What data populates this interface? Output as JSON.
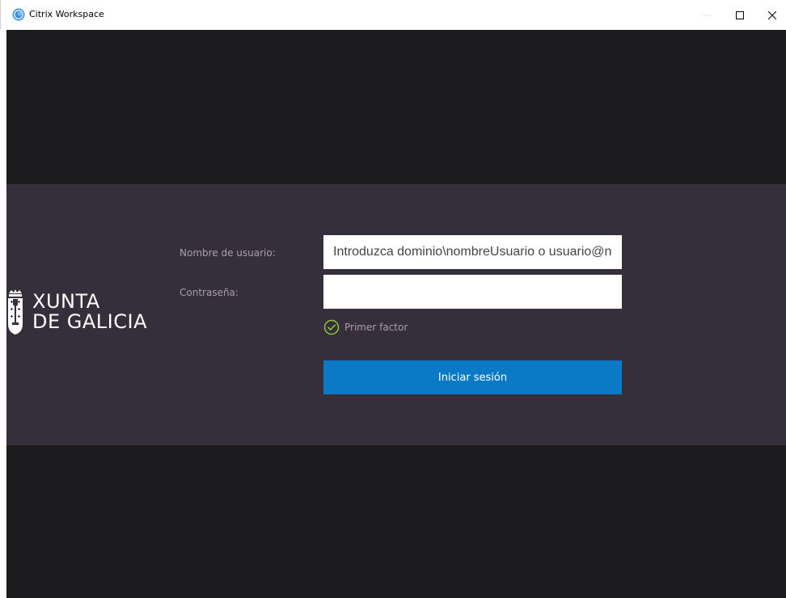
{
  "window": {
    "title": "Citrix Workspace",
    "icon": "citrix-workspace-icon",
    "controls": {
      "minimize_icon": "minimize-icon",
      "maximize_icon": "maximize-icon",
      "close_icon": "close-icon"
    }
  },
  "logo": {
    "line1": "XUNTA",
    "line2": "DE GALICIA",
    "icon": "galicia-crest-icon"
  },
  "form": {
    "username_label": "Nombre de usuario:",
    "username_placeholder": "Introduzca dominio\\nombreUsuario o usuario@n...",
    "username_value": "",
    "password_label": "Contraseña:",
    "password_value": "",
    "factor_text": "Primer factor",
    "factor_icon": "check-circle-icon",
    "submit_label": "Iniciar sesión"
  },
  "colors": {
    "background_dark": "#1b1a1d",
    "band": "#352e3b",
    "button_blue": "#0a7ac6",
    "check_green": "#8cc63f",
    "label_text": "#a8a0ad"
  }
}
